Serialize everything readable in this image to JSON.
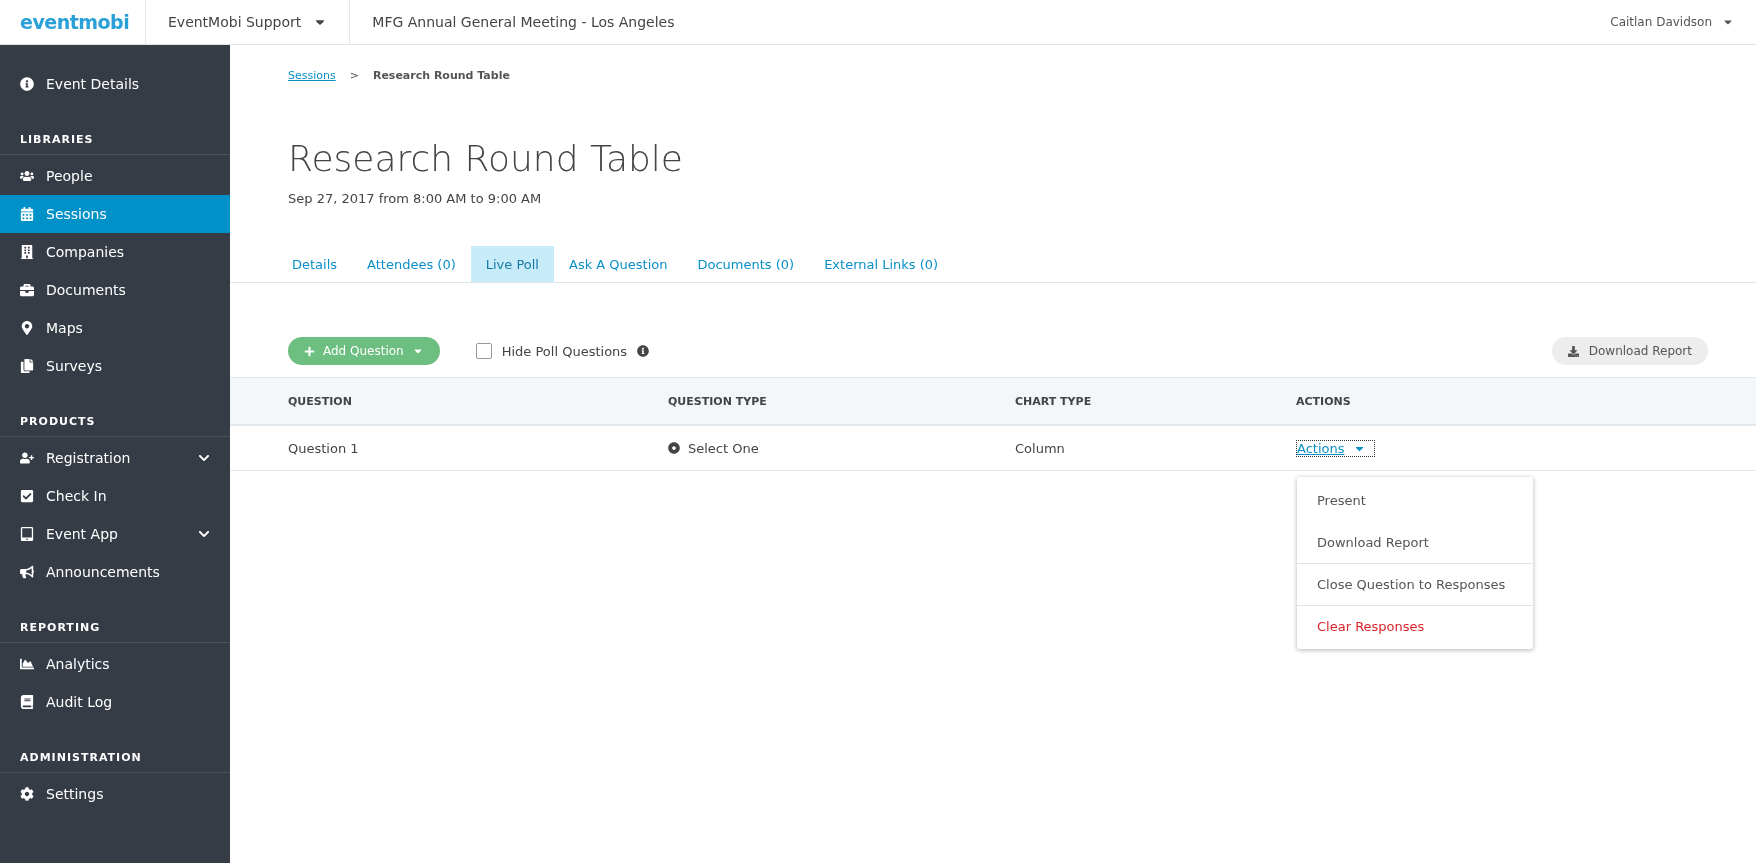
{
  "topbar": {
    "logo": "eventmobi",
    "org": "EventMobi Support",
    "event": "MFG Annual General Meeting - Los Angeles",
    "user": "Caitlan Davidson"
  },
  "sidebar": {
    "sections": [
      {
        "items": [
          {
            "label": "Event Details",
            "selected": false,
            "expandable": false
          }
        ]
      },
      {
        "heading": "LIBRARIES",
        "items": [
          {
            "label": "People",
            "selected": false,
            "expandable": false
          },
          {
            "label": "Sessions",
            "selected": true,
            "expandable": false
          },
          {
            "label": "Companies",
            "selected": false,
            "expandable": false
          },
          {
            "label": "Documents",
            "selected": false,
            "expandable": false
          },
          {
            "label": "Maps",
            "selected": false,
            "expandable": false
          },
          {
            "label": "Surveys",
            "selected": false,
            "expandable": false
          }
        ]
      },
      {
        "heading": "PRODUCTS",
        "items": [
          {
            "label": "Registration",
            "selected": false,
            "expandable": true
          },
          {
            "label": "Check In",
            "selected": false,
            "expandable": false
          },
          {
            "label": "Event App",
            "selected": false,
            "expandable": true
          },
          {
            "label": "Announcements",
            "selected": false,
            "expandable": false
          }
        ]
      },
      {
        "heading": "REPORTING",
        "items": [
          {
            "label": "Analytics",
            "selected": false,
            "expandable": false
          },
          {
            "label": "Audit Log",
            "selected": false,
            "expandable": false
          }
        ]
      },
      {
        "heading": "ADMINISTRATION",
        "items": [
          {
            "label": "Settings",
            "selected": false,
            "expandable": false
          }
        ]
      }
    ]
  },
  "breadcrumb": {
    "link": "Sessions",
    "separator": ">",
    "current": "Research Round Table"
  },
  "title": "Research Round Table",
  "subtitle": "Sep 27, 2017 from 8:00 AM to 9:00 AM",
  "tabs": [
    {
      "label": "Details",
      "selected": false
    },
    {
      "label": "Attendees (0)",
      "selected": false
    },
    {
      "label": "Live Poll",
      "selected": true
    },
    {
      "label": "Ask A Question",
      "selected": false
    },
    {
      "label": "Documents (0)",
      "selected": false
    },
    {
      "label": "External Links (0)",
      "selected": false
    }
  ],
  "toolbar": {
    "add_button": "Add Question",
    "hide_checkbox": {
      "label": "Hide Poll Questions",
      "checked": false
    },
    "download_button": "Download Report"
  },
  "table": {
    "columns": [
      "QUESTION",
      "QUESTION TYPE",
      "CHART TYPE",
      "ACTIONS"
    ],
    "rows": [
      {
        "question": "Question 1",
        "type": "Select One",
        "chart": "Column",
        "actions": "Actions"
      }
    ]
  },
  "menu": {
    "items": [
      {
        "label": "Present",
        "kind": "normal"
      },
      {
        "label": "Download Report",
        "kind": "normal"
      },
      {
        "label": "Close Question to Responses",
        "kind": "normal"
      },
      {
        "label": "Clear Responses",
        "kind": "danger"
      }
    ]
  }
}
